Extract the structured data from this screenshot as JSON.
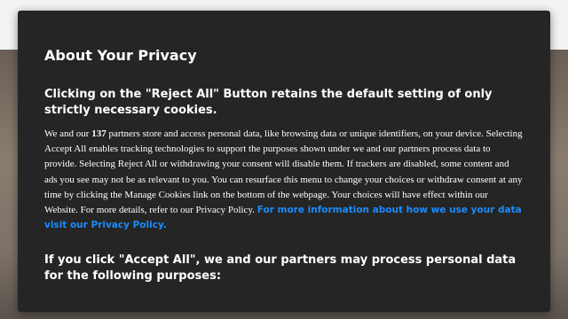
{
  "dialog": {
    "title": "About Your Privacy",
    "section1_heading": "Clicking on the \"Reject All\" Button retains the default setting of only strictly necessary cookies.",
    "body_prefix": "We and our ",
    "partner_count": "137",
    "body_rest": " partners store and access personal data, like browsing data or unique identifiers, on your device. Selecting Accept All enables tracking technologies to support the purposes shown under we and our partners process data to provide. Selecting Reject All or withdrawing your consent will disable them. If trackers are disabled, some content and ads you see may not be as relevant to you. You can resurface this menu to change your choices or withdraw consent at any time by clicking the Manage Cookies link on the bottom of the webpage. Your choices will have effect within our Website. For more details, refer to our Privacy Policy. ",
    "more_info_link": "For more information about how we use your data visit our Privacy Policy.",
    "section2_heading": "If you click \"Accept All\", we and our partners may process personal data for the following purposes:"
  },
  "colors": {
    "dialog_background": "#252525",
    "text": "#ffffff",
    "link": "#1a8cff"
  }
}
